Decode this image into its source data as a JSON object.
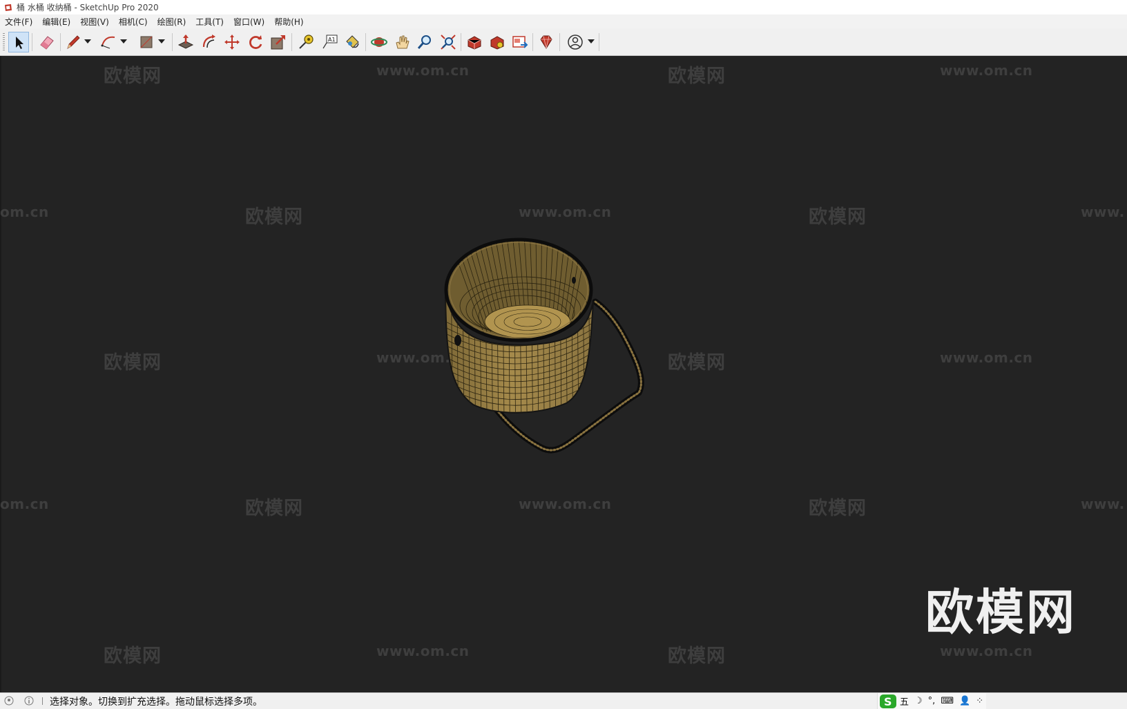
{
  "window": {
    "title": "桶 水桶 收纳桶 - SketchUp Pro 2020"
  },
  "menu": [
    "文件(F)",
    "编辑(E)",
    "视图(V)",
    "相机(C)",
    "绘图(R)",
    "工具(T)",
    "窗口(W)",
    "帮助(H)"
  ],
  "toolbar": {
    "tools": [
      "select-tool",
      "eraser-tool",
      "pencil-line-tool",
      "arc-tool",
      "rectangle-tool",
      "push-pull-tool",
      "offset-tool",
      "move-tool",
      "rotate-tool",
      "scale-tool",
      "tape-measure-tool",
      "text-tool",
      "paint-bucket-tool",
      "orbit-tool",
      "pan-tool",
      "zoom-tool",
      "zoom-extents-tool",
      "3d-warehouse-tool",
      "extension-warehouse-tool",
      "layout-send-tool",
      "extension-manager-tool",
      "account-tool"
    ],
    "active_tool": "select-tool"
  },
  "watermarks": {
    "site_cn": "欧模网",
    "site_url": "www.om.cn",
    "fragment_left": "om.cn",
    "fragment_right": "www.",
    "fragment_mid": "www.om.c"
  },
  "brand_watermark": "欧模网",
  "model": {
    "subject": "bucket with handle",
    "fill_color": "#9a8146",
    "edge_color": "#141414"
  },
  "statusbar": {
    "message": "选择对象。切换到扩充选择。拖动鼠标选择多项。",
    "ime_items": [
      "五",
      "☽",
      "°,",
      "⌨",
      "👤",
      "⁘"
    ],
    "ime_logo_color": "#2aa82a"
  }
}
